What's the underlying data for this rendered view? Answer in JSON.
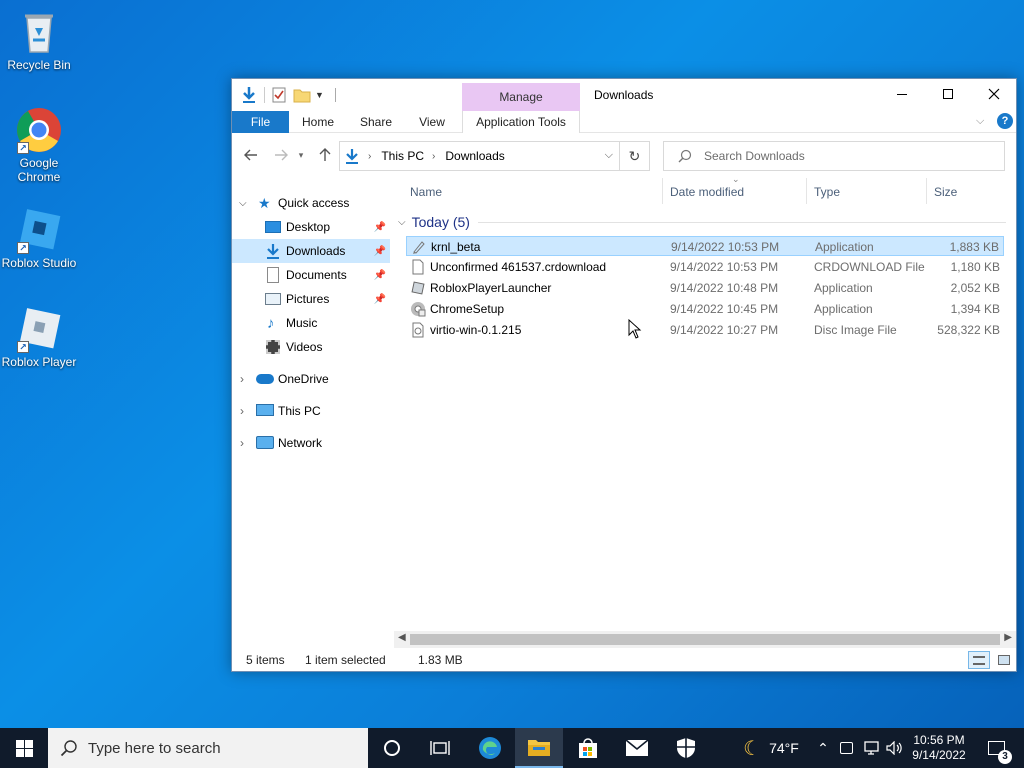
{
  "desktop": {
    "icons": [
      {
        "label": "Recycle Bin"
      },
      {
        "label": "Google Chrome"
      },
      {
        "label": "Roblox Studio"
      },
      {
        "label": "Roblox Player"
      }
    ]
  },
  "window": {
    "title": "Downloads",
    "manage_tab": "Manage",
    "ribbon": {
      "file": "File",
      "home": "Home",
      "share": "Share",
      "view": "View",
      "app_tools": "Application Tools"
    },
    "breadcrumb": [
      "This PC",
      "Downloads"
    ],
    "search_placeholder": "Search Downloads",
    "nav": {
      "quick_access": "Quick access",
      "items": [
        "Desktop",
        "Downloads",
        "Documents",
        "Pictures",
        "Music",
        "Videos"
      ],
      "onedrive": "OneDrive",
      "this_pc": "This PC",
      "network": "Network"
    },
    "columns": {
      "name": "Name",
      "date": "Date modified",
      "type": "Type",
      "size": "Size"
    },
    "group_label": "Today (5)",
    "files": [
      {
        "name": "krnl_beta",
        "date": "9/14/2022 10:53 PM",
        "type": "Application",
        "size": "1,883 KB"
      },
      {
        "name": "Unconfirmed 461537.crdownload",
        "date": "9/14/2022 10:53 PM",
        "type": "CRDOWNLOAD File",
        "size": "1,180 KB"
      },
      {
        "name": "RobloxPlayerLauncher",
        "date": "9/14/2022 10:48 PM",
        "type": "Application",
        "size": "2,052 KB"
      },
      {
        "name": "ChromeSetup",
        "date": "9/14/2022 10:45 PM",
        "type": "Application",
        "size": "1,394 KB"
      },
      {
        "name": "virtio-win-0.1.215",
        "date": "9/14/2022 10:27 PM",
        "type": "Disc Image File",
        "size": "528,322 KB"
      }
    ],
    "status": {
      "items": "5 items",
      "selected": "1 item selected",
      "size": "1.83 MB"
    }
  },
  "taskbar": {
    "search_placeholder": "Type here to search",
    "weather": "74°F",
    "time": "10:56 PM",
    "date": "9/14/2022",
    "notifications": "3"
  }
}
